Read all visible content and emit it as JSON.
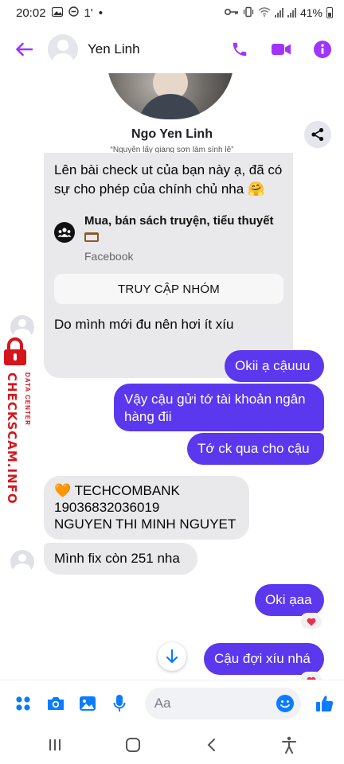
{
  "status_bar": {
    "time": "20:02",
    "left_indicators": [
      "1'",
      "•"
    ],
    "battery": "41%"
  },
  "header": {
    "contact_name": "Yen Linh"
  },
  "profile": {
    "name": "Ngo Yen Linh",
    "subtitle": "“Nguyên lấy giang sơn làm sính lễ”"
  },
  "shared_post": {
    "text": "Lên bài check ut của bạn này ạ, đã có sự cho phép của chính chủ nha 🤗",
    "group_name": "Mua, bán sách truyện, tiểu thuyết",
    "source": "Facebook",
    "visit_button": "TRUY CẬP NHÓM"
  },
  "messages": [
    {
      "side": "in",
      "text": "Do mình mới đu nên hơi ít xíu"
    },
    {
      "side": "out",
      "text": "Okii ạ cậuuu"
    },
    {
      "side": "out",
      "text": "Vậy cậu gửi tớ tài khoản ngân hàng đii"
    },
    {
      "side": "out",
      "text": "Tớ ck qua cho cậu"
    },
    {
      "side": "in",
      "text_lines": [
        "🧡 TECHCOMBANK",
        "19036832036019",
        "NGUYEN THI MINH NGUYET"
      ]
    },
    {
      "side": "in",
      "text": "Mình fix còn 251 nha"
    },
    {
      "side": "out",
      "text": "Oki ạaa",
      "reaction": "heart"
    },
    {
      "side": "out",
      "text": "Cậu đợi xíu nhá",
      "reaction": "heart"
    }
  ],
  "watermark": {
    "main": "CHECKSCAM.INFO",
    "sub": "DATA CENTER"
  },
  "composer": {
    "placeholder": "Aa"
  },
  "colors": {
    "accent": "#a033ff",
    "outgoing_bubble": "#5b37ee",
    "incoming_bubble": "#e9e9eb",
    "composer_icons": "#0a7cff",
    "watermark": "#d4161c"
  }
}
